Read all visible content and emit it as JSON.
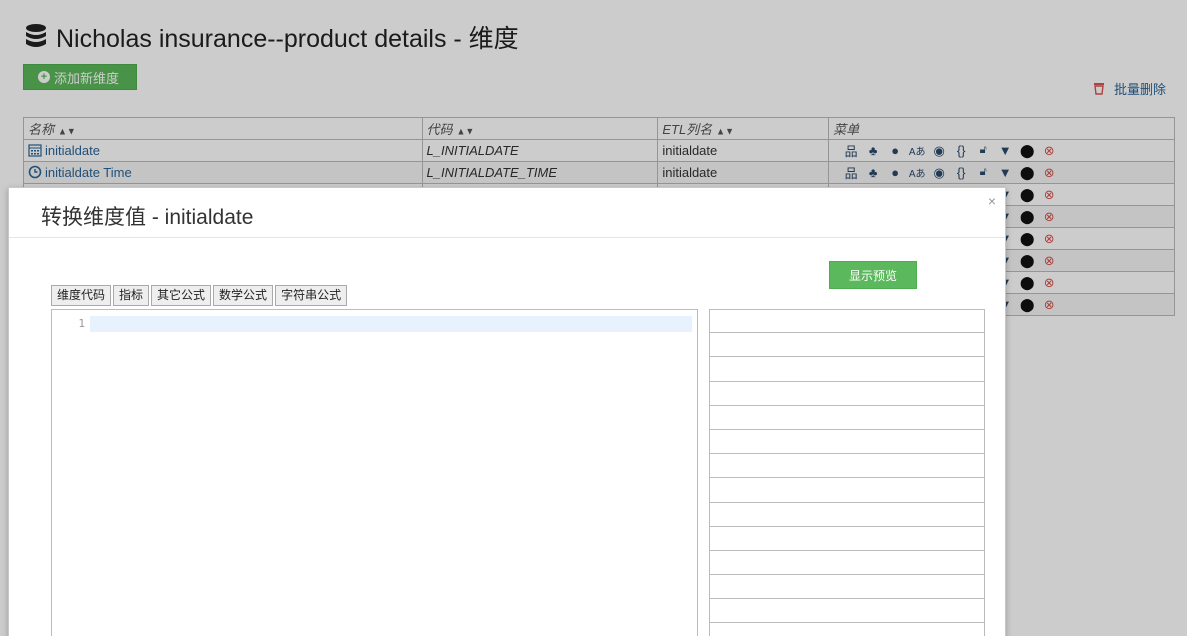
{
  "page": {
    "title": "Nicholas insurance--product details - 维度",
    "add_button": "添加新维度",
    "batch_delete": "批量删除"
  },
  "table": {
    "headers": [
      "名称",
      "代码",
      "ETL列名",
      "菜单"
    ],
    "rows": [
      {
        "icon": "calendar-icon",
        "name": "initialdate",
        "code": "L_INITIALDATE",
        "etl": "initialdate"
      },
      {
        "icon": "clock-icon",
        "name": "initialdate Time",
        "code": "L_INITIALDATE_TIME",
        "etl": "initialdate"
      },
      {
        "icon": "",
        "name": "",
        "code": "",
        "etl": ""
      },
      {
        "icon": "",
        "name": "",
        "code": "",
        "etl": ""
      },
      {
        "icon": "",
        "name": "",
        "code": "",
        "etl": ""
      },
      {
        "icon": "",
        "name": "",
        "code": "",
        "etl": ""
      },
      {
        "icon": "",
        "name": "",
        "code": "",
        "etl": ""
      },
      {
        "icon": "",
        "name": "",
        "code": "",
        "etl": ""
      }
    ],
    "menu_icons": [
      "hierarchy-icon",
      "tree-icon",
      "palette-icon",
      "translate-icon",
      "eye-icon",
      "braces-icon",
      "unlock-icon",
      "filter-icon",
      "map-marker-icon",
      "delete-circle-icon"
    ]
  },
  "modal": {
    "title": "转换维度值 - initialdate",
    "close": "×",
    "preview_button": "显示预览",
    "tabs": [
      "维度代码",
      "指标",
      "其它公式",
      "数学公式",
      "字符串公式"
    ],
    "editor_line": "1"
  },
  "colors": {
    "accent_green": "#5cb85c",
    "link_blue": "#2a6496",
    "delete_red": "#d9534f"
  }
}
